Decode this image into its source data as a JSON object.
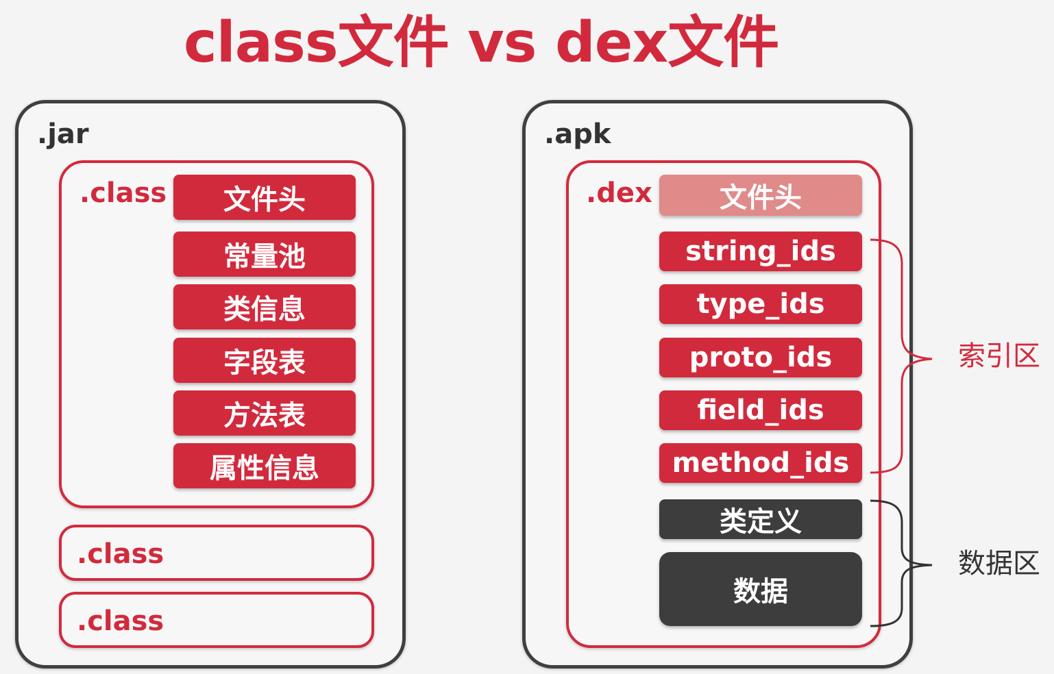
{
  "title": "class文件 vs dex文件",
  "jar": {
    "label": ".jar",
    "class_main": {
      "label": ".class",
      "sections": [
        "文件头",
        "常量池",
        "类信息",
        "字段表",
        "方法表",
        "属性信息"
      ]
    },
    "class_extra": [
      ".class",
      ".class"
    ]
  },
  "apk": {
    "label": ".apk",
    "dex": {
      "label": ".dex",
      "header": "文件头",
      "index_sections": [
        "string_ids",
        "type_ids",
        "proto_ids",
        "field_ids",
        "method_ids"
      ],
      "data_sections": [
        "类定义",
        "数据"
      ]
    }
  },
  "annotations": {
    "index_area": "索引区",
    "data_area": "数据区"
  },
  "colors": {
    "accent_red": "#d22a3d",
    "header_pink": "#e08a8a",
    "dark_block": "#3d3d3d"
  }
}
